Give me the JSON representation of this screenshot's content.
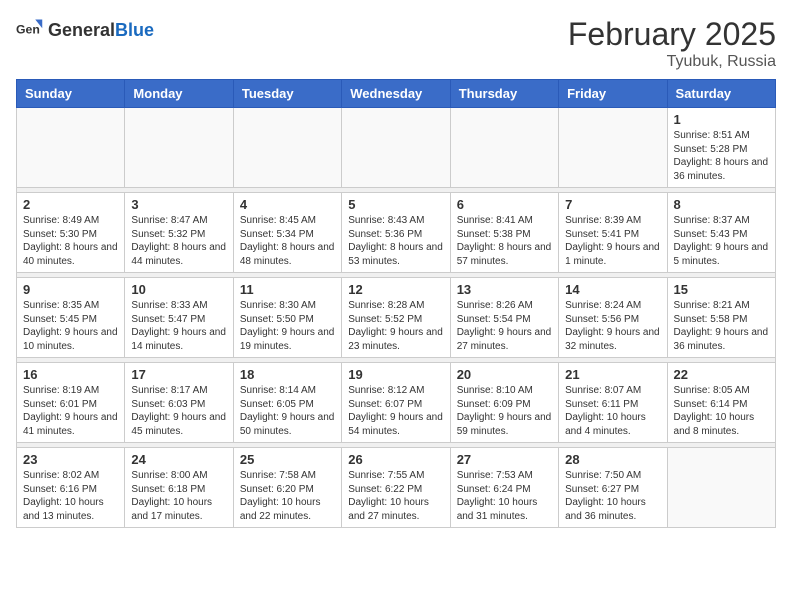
{
  "logo": {
    "general": "General",
    "blue": "Blue"
  },
  "title": {
    "month": "February 2025",
    "location": "Tyubuk, Russia"
  },
  "weekdays": [
    "Sunday",
    "Monday",
    "Tuesday",
    "Wednesday",
    "Thursday",
    "Friday",
    "Saturday"
  ],
  "weeks": [
    [
      {
        "day": "",
        "info": ""
      },
      {
        "day": "",
        "info": ""
      },
      {
        "day": "",
        "info": ""
      },
      {
        "day": "",
        "info": ""
      },
      {
        "day": "",
        "info": ""
      },
      {
        "day": "",
        "info": ""
      },
      {
        "day": "1",
        "info": "Sunrise: 8:51 AM\nSunset: 5:28 PM\nDaylight: 8 hours and 36 minutes."
      }
    ],
    [
      {
        "day": "2",
        "info": "Sunrise: 8:49 AM\nSunset: 5:30 PM\nDaylight: 8 hours and 40 minutes."
      },
      {
        "day": "3",
        "info": "Sunrise: 8:47 AM\nSunset: 5:32 PM\nDaylight: 8 hours and 44 minutes."
      },
      {
        "day": "4",
        "info": "Sunrise: 8:45 AM\nSunset: 5:34 PM\nDaylight: 8 hours and 48 minutes."
      },
      {
        "day": "5",
        "info": "Sunrise: 8:43 AM\nSunset: 5:36 PM\nDaylight: 8 hours and 53 minutes."
      },
      {
        "day": "6",
        "info": "Sunrise: 8:41 AM\nSunset: 5:38 PM\nDaylight: 8 hours and 57 minutes."
      },
      {
        "day": "7",
        "info": "Sunrise: 8:39 AM\nSunset: 5:41 PM\nDaylight: 9 hours and 1 minute."
      },
      {
        "day": "8",
        "info": "Sunrise: 8:37 AM\nSunset: 5:43 PM\nDaylight: 9 hours and 5 minutes."
      }
    ],
    [
      {
        "day": "9",
        "info": "Sunrise: 8:35 AM\nSunset: 5:45 PM\nDaylight: 9 hours and 10 minutes."
      },
      {
        "day": "10",
        "info": "Sunrise: 8:33 AM\nSunset: 5:47 PM\nDaylight: 9 hours and 14 minutes."
      },
      {
        "day": "11",
        "info": "Sunrise: 8:30 AM\nSunset: 5:50 PM\nDaylight: 9 hours and 19 minutes."
      },
      {
        "day": "12",
        "info": "Sunrise: 8:28 AM\nSunset: 5:52 PM\nDaylight: 9 hours and 23 minutes."
      },
      {
        "day": "13",
        "info": "Sunrise: 8:26 AM\nSunset: 5:54 PM\nDaylight: 9 hours and 27 minutes."
      },
      {
        "day": "14",
        "info": "Sunrise: 8:24 AM\nSunset: 5:56 PM\nDaylight: 9 hours and 32 minutes."
      },
      {
        "day": "15",
        "info": "Sunrise: 8:21 AM\nSunset: 5:58 PM\nDaylight: 9 hours and 36 minutes."
      }
    ],
    [
      {
        "day": "16",
        "info": "Sunrise: 8:19 AM\nSunset: 6:01 PM\nDaylight: 9 hours and 41 minutes."
      },
      {
        "day": "17",
        "info": "Sunrise: 8:17 AM\nSunset: 6:03 PM\nDaylight: 9 hours and 45 minutes."
      },
      {
        "day": "18",
        "info": "Sunrise: 8:14 AM\nSunset: 6:05 PM\nDaylight: 9 hours and 50 minutes."
      },
      {
        "day": "19",
        "info": "Sunrise: 8:12 AM\nSunset: 6:07 PM\nDaylight: 9 hours and 54 minutes."
      },
      {
        "day": "20",
        "info": "Sunrise: 8:10 AM\nSunset: 6:09 PM\nDaylight: 9 hours and 59 minutes."
      },
      {
        "day": "21",
        "info": "Sunrise: 8:07 AM\nSunset: 6:11 PM\nDaylight: 10 hours and 4 minutes."
      },
      {
        "day": "22",
        "info": "Sunrise: 8:05 AM\nSunset: 6:14 PM\nDaylight: 10 hours and 8 minutes."
      }
    ],
    [
      {
        "day": "23",
        "info": "Sunrise: 8:02 AM\nSunset: 6:16 PM\nDaylight: 10 hours and 13 minutes."
      },
      {
        "day": "24",
        "info": "Sunrise: 8:00 AM\nSunset: 6:18 PM\nDaylight: 10 hours and 17 minutes."
      },
      {
        "day": "25",
        "info": "Sunrise: 7:58 AM\nSunset: 6:20 PM\nDaylight: 10 hours and 22 minutes."
      },
      {
        "day": "26",
        "info": "Sunrise: 7:55 AM\nSunset: 6:22 PM\nDaylight: 10 hours and 27 minutes."
      },
      {
        "day": "27",
        "info": "Sunrise: 7:53 AM\nSunset: 6:24 PM\nDaylight: 10 hours and 31 minutes."
      },
      {
        "day": "28",
        "info": "Sunrise: 7:50 AM\nSunset: 6:27 PM\nDaylight: 10 hours and 36 minutes."
      },
      {
        "day": "",
        "info": ""
      }
    ]
  ]
}
